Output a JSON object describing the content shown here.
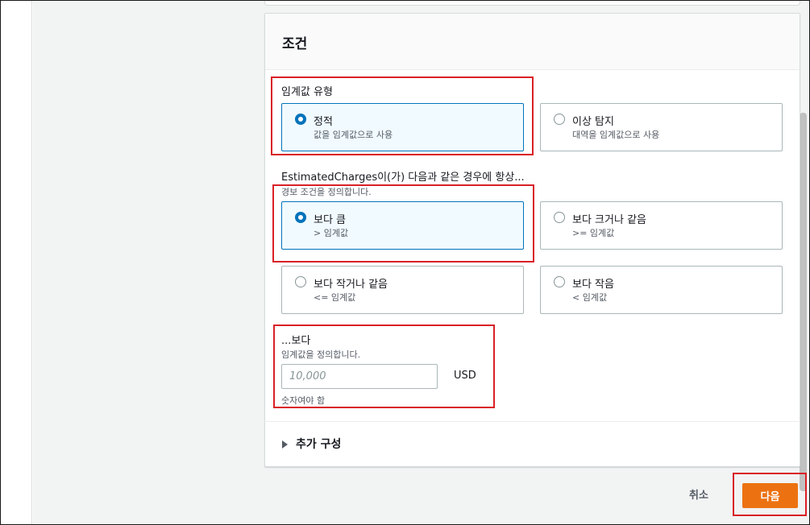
{
  "section": {
    "title": "조건"
  },
  "threshold_type": {
    "label": "임계값 유형",
    "options": [
      {
        "title": "정적",
        "description": "값을 임계값으로 사용",
        "selected": true
      },
      {
        "title": "이상 탐지",
        "description": "대역을 임계값으로 사용",
        "selected": false
      }
    ]
  },
  "condition": {
    "label": "EstimatedCharges이(가) 다음과 같은 경우에 항상...",
    "description": "경보 조건을 정의합니다.",
    "options": [
      {
        "title": "보다 큼",
        "description": "> 임계값",
        "selected": true
      },
      {
        "title": "보다 크거나 같음",
        "description": ">= 임계값",
        "selected": false
      },
      {
        "title": "보다 작거나 같음",
        "description": "<= 임계값",
        "selected": false
      },
      {
        "title": "보다 작음",
        "description": "< 임계값",
        "selected": false
      }
    ]
  },
  "threshold_value": {
    "label": "...보다",
    "description": "임계값을 정의합니다.",
    "value": "",
    "placeholder": "10,000",
    "unit": "USD",
    "constraint": "숫자여야 함"
  },
  "additional_config": {
    "label": "추가 구성"
  },
  "footer": {
    "cancel_label": "취소",
    "next_label": "다음"
  },
  "colors": {
    "accent": "#0073bb",
    "primary_button": "#ec7211",
    "highlight_box": "#d92026"
  }
}
